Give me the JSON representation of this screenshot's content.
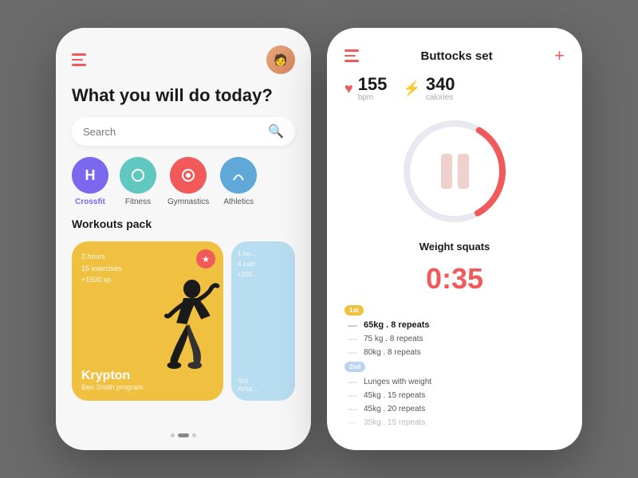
{
  "leftPhone": {
    "title": "What you will do today?",
    "search": {
      "placeholder": "Search"
    },
    "categories": [
      {
        "id": "crossfit",
        "label": "Crossfit",
        "color": "#7b68ee",
        "initial": "H",
        "active": true
      },
      {
        "id": "fitness",
        "label": "Fitness",
        "color": "#60c8c0",
        "initial": "◯"
      },
      {
        "id": "gymnastics",
        "label": "Gymnastics",
        "color": "#f05a5a",
        "initial": "◎"
      },
      {
        "id": "athletics",
        "label": "Athletics",
        "color": "#60a8d8",
        "initial": "⌀"
      }
    ],
    "sectionTitle": "Workouts pack",
    "workoutMain": {
      "hours": "2 hours",
      "exercises": "15 exercises",
      "xp": "+1500 xp",
      "name": "Krypton",
      "sub": "Ben Smith program"
    },
    "workoutSecondary": {
      "hours": "1 ho...",
      "exercises": "4 exer...",
      "xp": "+200..."
    }
  },
  "rightPhone": {
    "title": "Buttocks set",
    "plusLabel": "+",
    "stats": {
      "bpm": {
        "value": "155",
        "label": "bpm",
        "iconColor": "#f05a5a"
      },
      "calories": {
        "value": "340",
        "label": "calories",
        "iconColor": "#f0c040"
      }
    },
    "exerciseName": "Weight squats",
    "timer": "0:35",
    "sets": [
      {
        "badge": "1st",
        "badgeType": "first",
        "exercises": [
          {
            "text": "65kg . 8 repeats",
            "highlight": true
          },
          {
            "text": "75 kg . 8 repeats",
            "highlight": false
          },
          {
            "text": "80kg . 8 repeats",
            "highlight": false
          }
        ]
      },
      {
        "badge": "2nd",
        "badgeType": "second",
        "exercises": [
          {
            "text": "Lunges with weight",
            "highlight": false
          },
          {
            "text": "45kg . 15 repeats",
            "highlight": false
          },
          {
            "text": "45kg . 20 repeats",
            "highlight": false
          },
          {
            "text": "35kg . 15 repeats",
            "highlight": false
          }
        ]
      }
    ]
  }
}
